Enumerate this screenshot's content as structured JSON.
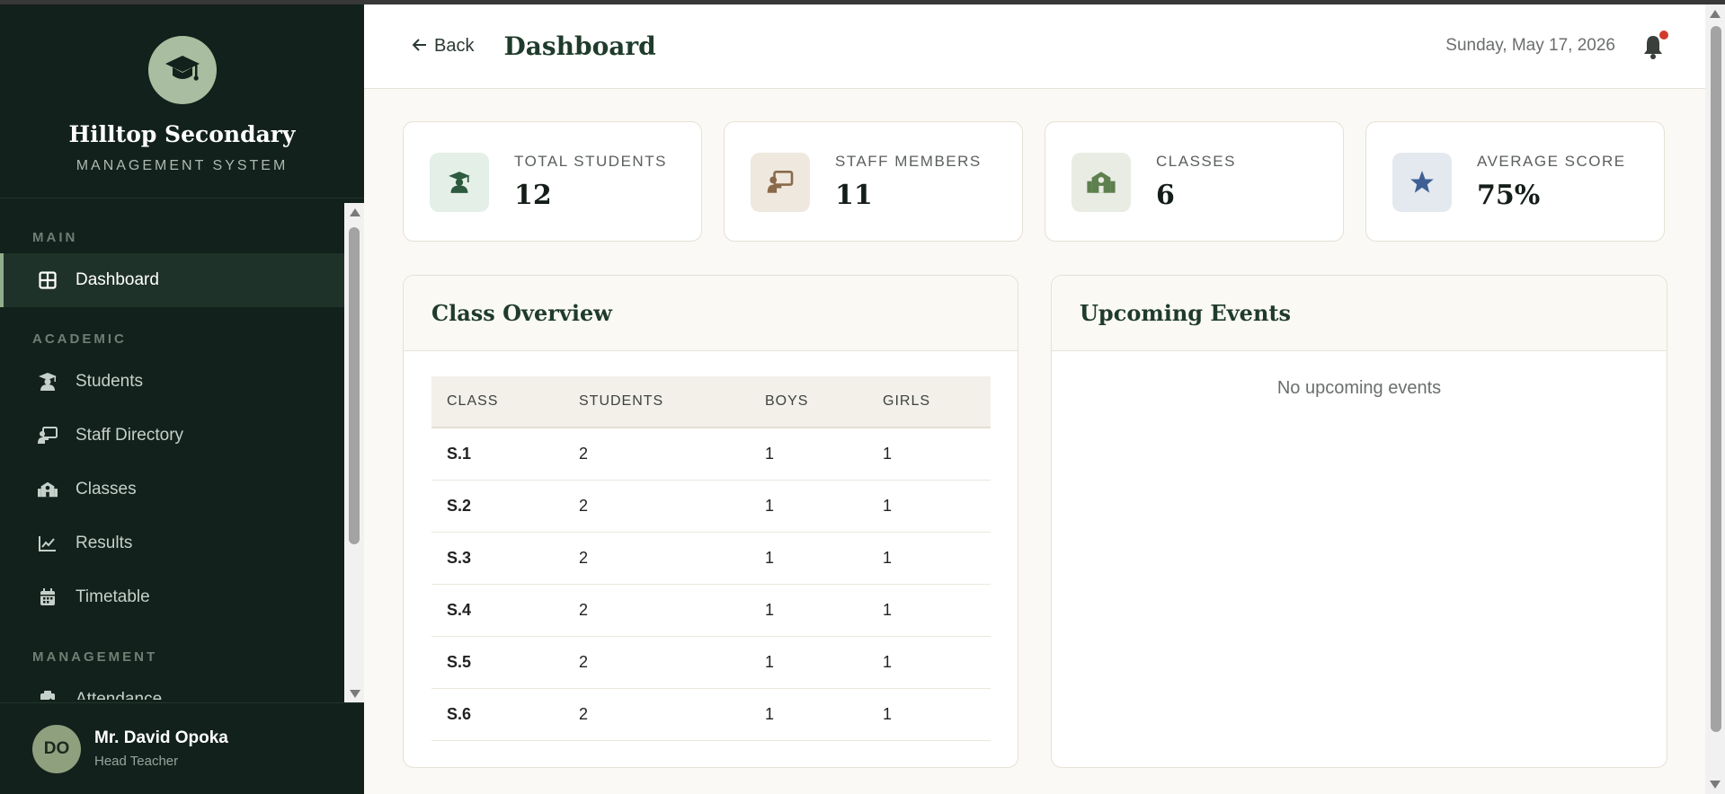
{
  "sidebar": {
    "brand_name": "Hilltop Secondary",
    "brand_sub": "MANAGEMENT SYSTEM",
    "sections": {
      "main": "MAIN",
      "academic": "ACADEMIC",
      "management": "MANAGEMENT"
    },
    "items": {
      "dashboard": "Dashboard",
      "students": "Students",
      "staff": "Staff Directory",
      "classes": "Classes",
      "results": "Results",
      "timetable": "Timetable",
      "attendance": "Attendance"
    },
    "active": "dashboard",
    "user": {
      "initials": "DO",
      "name": "Mr. David Opoka",
      "role": "Head Teacher"
    }
  },
  "topbar": {
    "back_label": "Back",
    "title": "Dashboard",
    "date": "Sunday, May 17, 2026",
    "has_notification": true
  },
  "stats": [
    {
      "label": "TOTAL STUDENTS",
      "value": "12",
      "icon": "graduate-icon",
      "bg": "#e4efe7",
      "fg": "#2e5a3f"
    },
    {
      "label": "STAFF MEMBERS",
      "value": "11",
      "icon": "teacher-board-icon",
      "bg": "#efe8df",
      "fg": "#8a6a4a"
    },
    {
      "label": "CLASSES",
      "value": "6",
      "icon": "school-icon",
      "bg": "#e8ece2",
      "fg": "#5e7f4e"
    },
    {
      "label": "AVERAGE SCORE",
      "value": "75%",
      "icon": "star-icon",
      "bg": "#e4e9ef",
      "fg": "#3e5f94"
    }
  ],
  "class_overview": {
    "title": "Class Overview",
    "columns": [
      "CLASS",
      "STUDENTS",
      "BOYS",
      "GIRLS"
    ],
    "rows": [
      [
        "S.1",
        "2",
        "1",
        "1"
      ],
      [
        "S.2",
        "2",
        "1",
        "1"
      ],
      [
        "S.3",
        "2",
        "1",
        "1"
      ],
      [
        "S.4",
        "2",
        "1",
        "1"
      ],
      [
        "S.5",
        "2",
        "1",
        "1"
      ],
      [
        "S.6",
        "2",
        "1",
        "1"
      ]
    ]
  },
  "events": {
    "title": "Upcoming Events",
    "empty_text": "No upcoming events"
  },
  "colors": {
    "sidebar_bg": "#12211b",
    "accent": "#8fae8a",
    "title": "#1f3b2c",
    "notification": "#d23a2c"
  }
}
